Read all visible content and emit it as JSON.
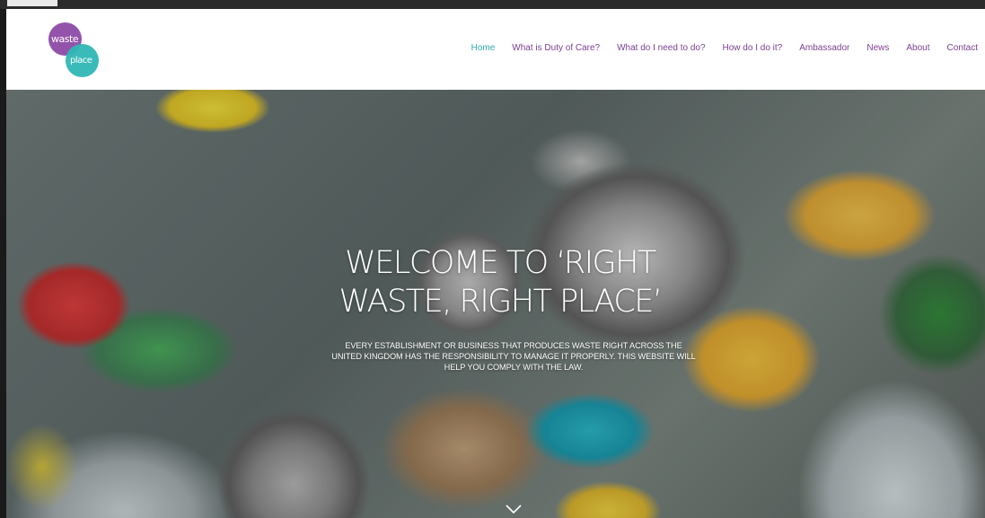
{
  "site": {
    "logo": {
      "line1": "waste",
      "line2": "place"
    },
    "nav": [
      {
        "label": "Home",
        "active": true
      },
      {
        "label": "What is Duty of Care?",
        "active": false
      },
      {
        "label": "What do I need to do?",
        "active": false
      },
      {
        "label": "How do I do it?",
        "active": false
      },
      {
        "label": "Ambassador",
        "active": false
      },
      {
        "label": "News",
        "active": false
      },
      {
        "label": "About",
        "active": false
      },
      {
        "label": "Contact",
        "active": false
      }
    ]
  },
  "hero": {
    "title_line1": "WELCOME TO ‘RIGHT",
    "title_line2": "WASTE, RIGHT PLACE’",
    "subtitle_line1": "EVERY ESTABLISHMENT OR BUSINESS THAT PRODUCES WASTE RIGHT ACROSS THE",
    "subtitle_line2": "UNITED KINGDOM HAS THE RESPONSIBILITY TO MANAGE IT PROPERLY.  THIS WEBSITE WILL",
    "subtitle_line3": "HELP YOU COMPLY WITH THE LAW.",
    "scroll_icon": "chevron-down-icon"
  },
  "colors": {
    "nav_link": "#7b3f93",
    "nav_active": "#2fa9b0",
    "logo_purple": "#8d4aa6",
    "logo_teal": "#2fb7b5"
  }
}
